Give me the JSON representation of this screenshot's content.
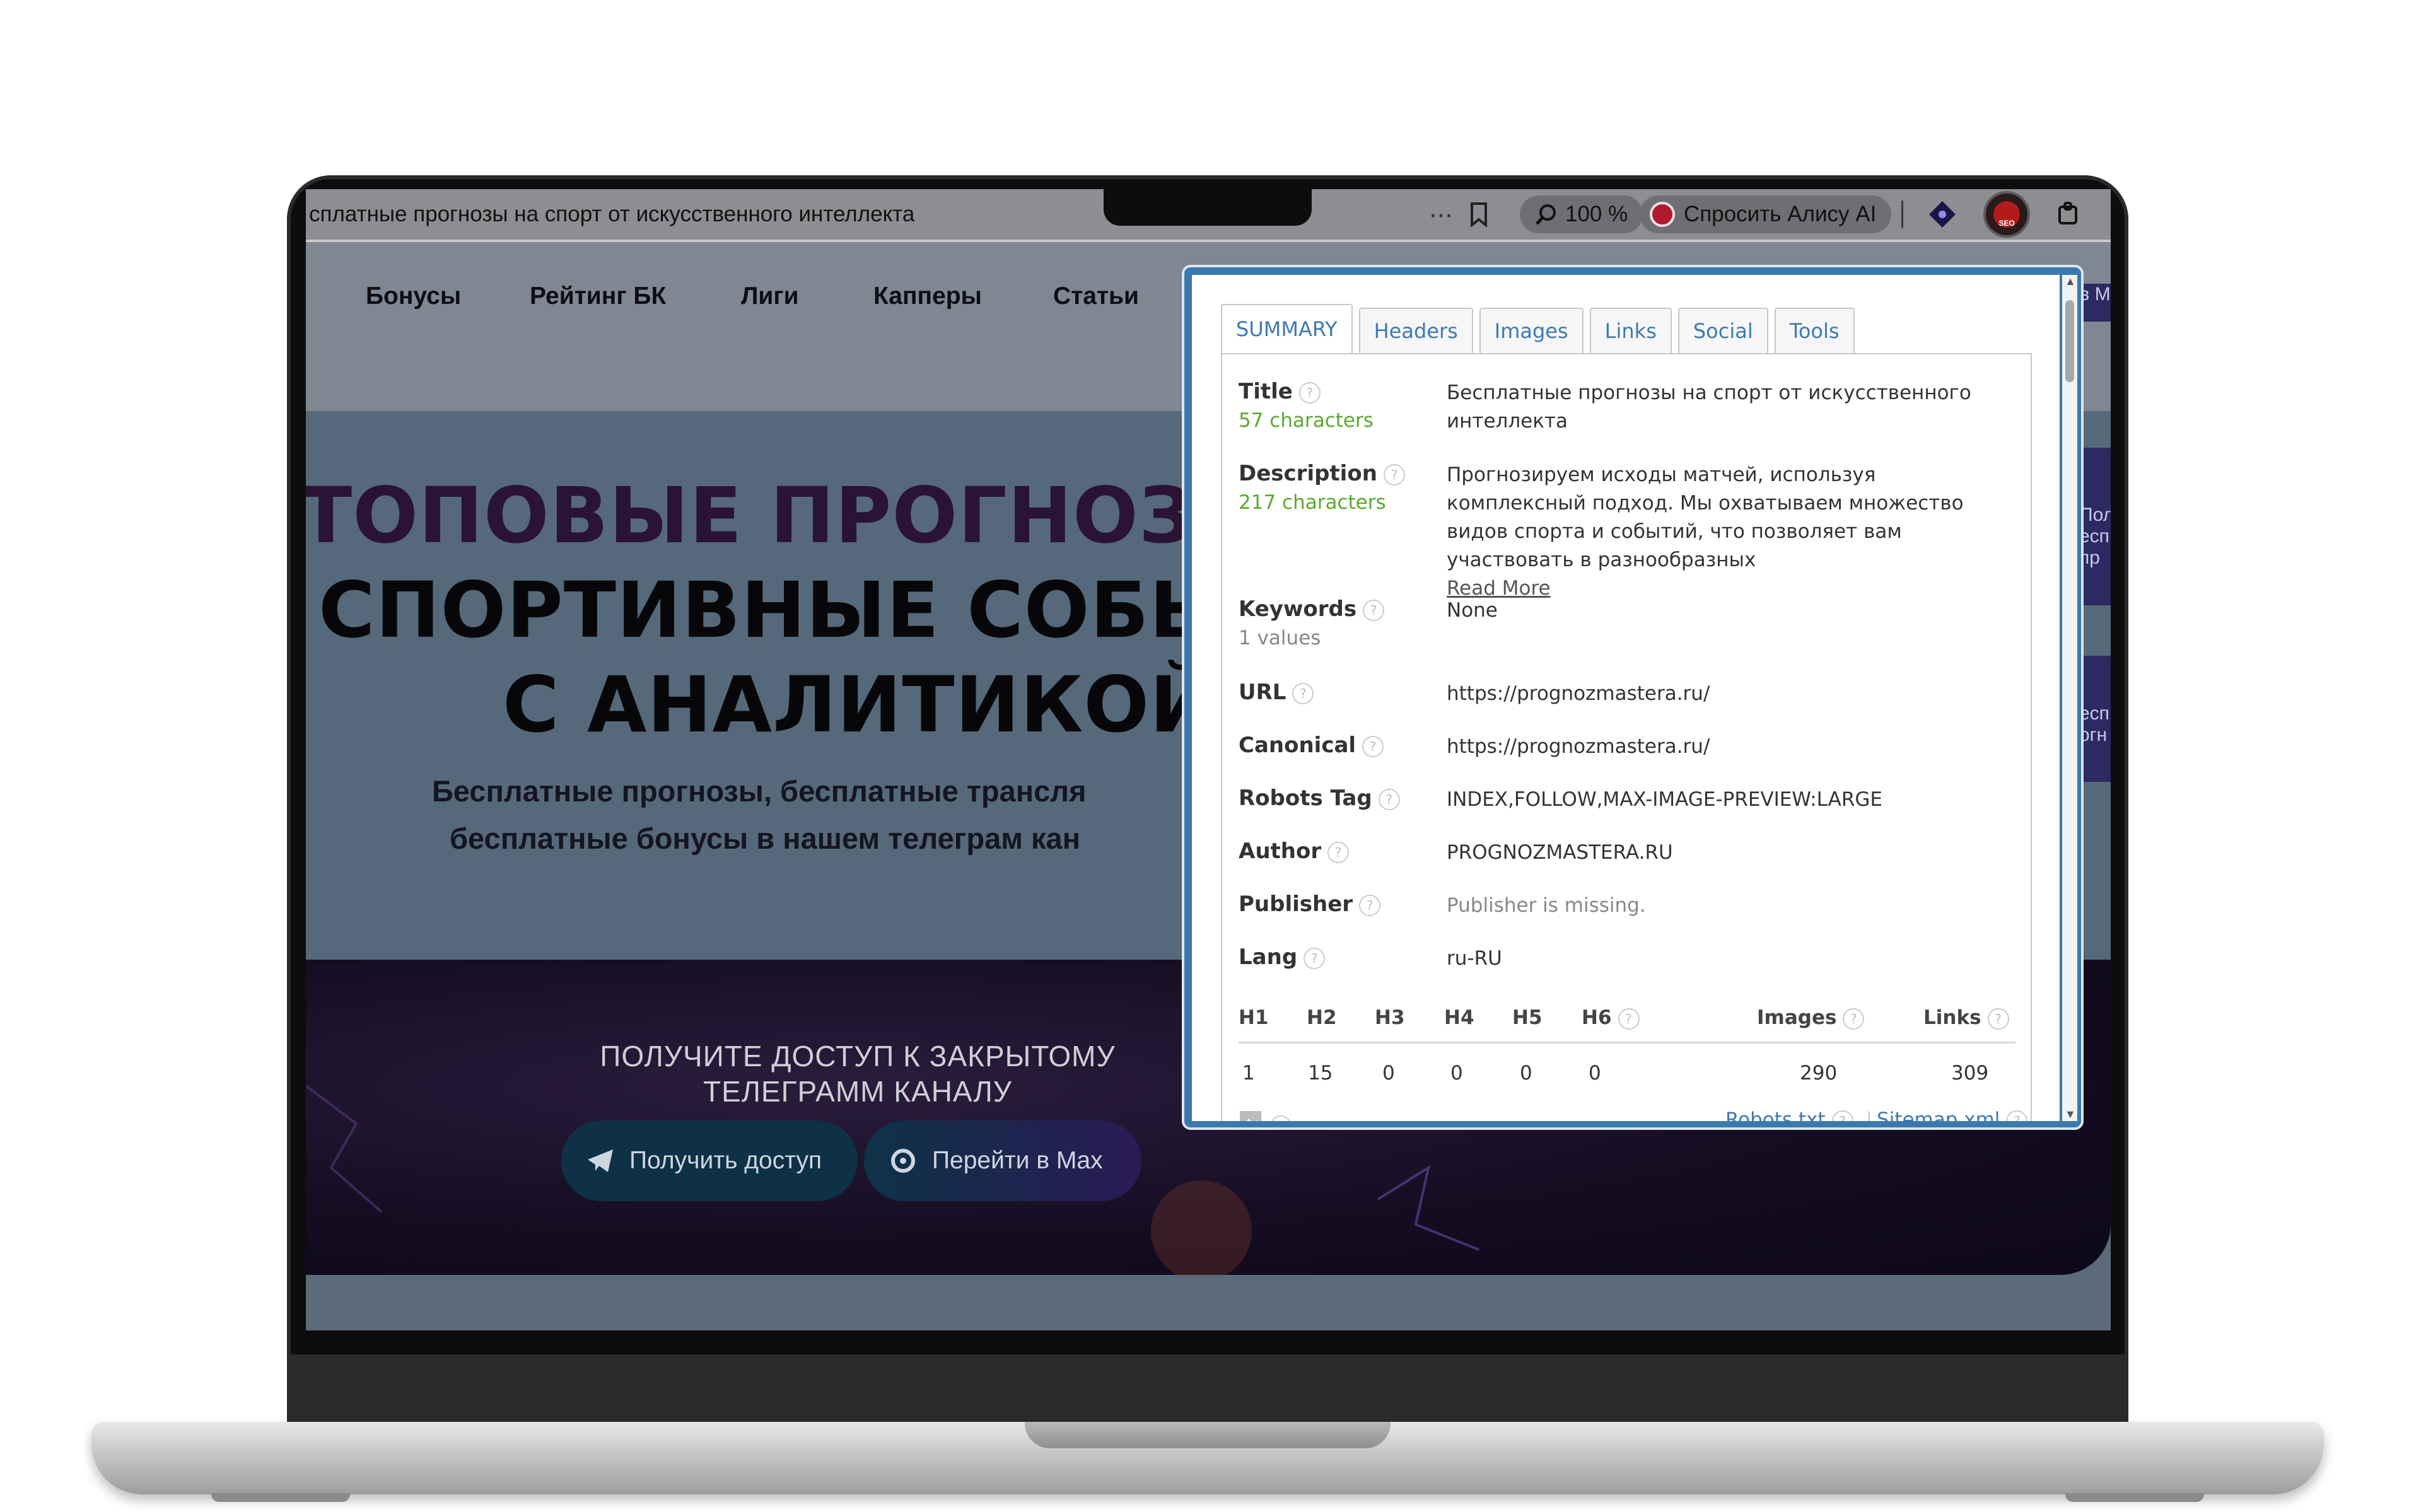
{
  "browser": {
    "tab_title": "сплатные прогнозы на спорт от искусственного интеллекта",
    "more": "···",
    "zoom": "100 %",
    "alice": "Спросить Алису AI"
  },
  "site": {
    "nav": [
      "Бонусы",
      "Рейтинг БК",
      "Лиги",
      "Капперы",
      "Статьи"
    ],
    "hero_line1": "ТОПОВЫЕ ПРОГНОЗЫ",
    "hero_line2": "СПОРТИВНЫЕ СОБЫ",
    "hero_line3": "С АНАЛИТИКОЙ",
    "hero_sub1": "Бесплатные прогнозы, бесплатные трансля",
    "hero_sub2": "бесплатные бонусы в нашем телеграм кан",
    "cta_title": "ПОЛУЧИТЕ ДОСТУП К ЗАКРЫТОМУ\nТЕЛЕГРАММ КАНАЛУ",
    "cta_telegram": "Получить доступ",
    "cta_max": "Перейти в Max",
    "right_sliver_top": "в М",
    "right_sliver_mid": "Пол\nесп\nпр",
    "right_sliver_low": "есп\nогн"
  },
  "seo": {
    "tabs": [
      "SUMMARY",
      "Headers",
      "Images",
      "Links",
      "Social",
      "Tools"
    ],
    "active_tab": "SUMMARY",
    "title": {
      "label": "Title",
      "meta": "57 characters",
      "value": "Бесплатные прогнозы на спорт от искусственного интеллекта"
    },
    "description": {
      "label": "Description",
      "meta": "217 characters",
      "value": "Прогнозируем исходы матчей, используя комплексный подход. Мы охватываем множество видов спорта и событий, что позволяет вам участвовать в разнообразных",
      "read_more": "Read More"
    },
    "keywords": {
      "label": "Keywords",
      "meta": "1 values",
      "value": "None"
    },
    "url": {
      "label": "URL",
      "value": "https://prognozmastera.ru/"
    },
    "canonical": {
      "label": "Canonical",
      "value": "https://prognozmastera.ru/"
    },
    "robots": {
      "label": "Robots Tag",
      "value": "INDEX,FOLLOW,MAX-IMAGE-PREVIEW:LARGE"
    },
    "author": {
      "label": "Author",
      "value": "PROGNOZMASTERA.RU"
    },
    "publisher": {
      "label": "Publisher",
      "value": "Publisher is missing."
    },
    "lang": {
      "label": "Lang",
      "value": "ru-RU"
    },
    "headers_table": {
      "h1": "H1",
      "h2": "H2",
      "h3": "H3",
      "h4": "H4",
      "h5": "H5",
      "h6": "H6",
      "images": "Images",
      "links": "Links",
      "v_h1": "1",
      "v_h2": "15",
      "v_h3": "0",
      "v_h4": "0",
      "v_h5": "0",
      "v_h6": "0",
      "v_images": "290",
      "v_links": "309"
    },
    "robots_txt": "Robots.txt",
    "sitemap": "Sitemap.xml",
    "help": "?"
  },
  "colors": {
    "accent": "#3d7ab3",
    "popup_border": "#3a79ad",
    "meta_green": "#5aaa2e"
  }
}
